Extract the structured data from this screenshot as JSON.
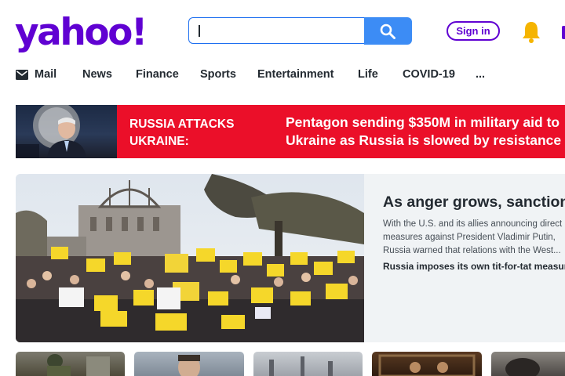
{
  "header": {
    "logo_text": "yahoo!",
    "brand_color": "#6001d2",
    "search": {
      "value": "",
      "placeholder": ""
    },
    "search_icon": "magnifier-icon",
    "signin_label": "Sign in",
    "notification_icon": "bell-icon",
    "notification_color": "#f5b400"
  },
  "nav": {
    "items": [
      {
        "label": "Mail",
        "icon": "envelope-icon"
      },
      {
        "label": "News"
      },
      {
        "label": "Finance"
      },
      {
        "label": "Sports"
      },
      {
        "label": "Entertainment"
      },
      {
        "label": "Life"
      },
      {
        "label": "COVID-19"
      },
      {
        "label": "..."
      }
    ]
  },
  "breaking": {
    "label": "RUSSIA ATTACKS UKRAINE:",
    "headline": "Pentagon sending $350M in military aid to Ukraine as Russia is slowed by resistance",
    "accent_color": "#eb0f29"
  },
  "hero": {
    "title": "As anger grows, sanctions swing toward Putin",
    "summary": [
      "With the U.S. and its allies announcing direct",
      "measures against President Vladimir Putin,",
      "Russia warned that relations with the West..."
    ],
    "related": "Russia imposes its own tit-for-tat measures"
  },
  "thumbnails": {
    "count": 5
  }
}
